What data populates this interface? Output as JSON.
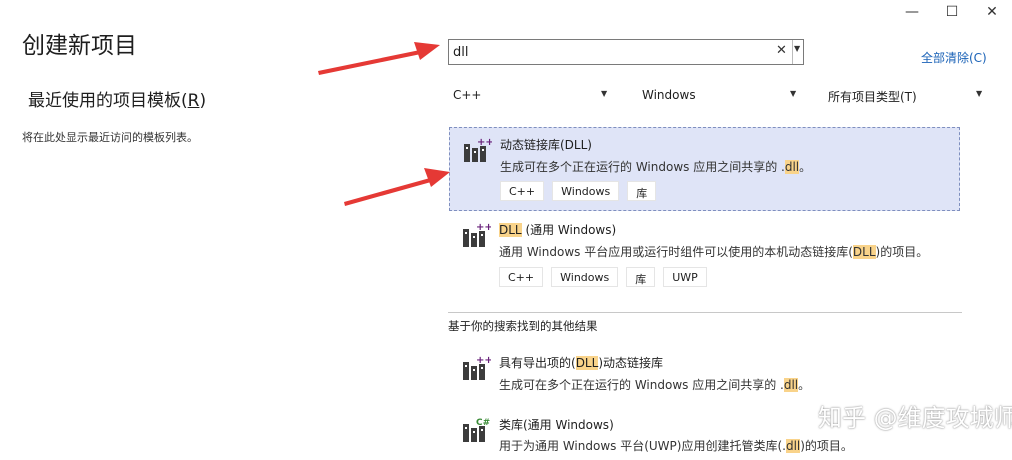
{
  "window": {
    "minimize_glyph": "—",
    "maximize_glyph": "☐",
    "close_glyph": "✕"
  },
  "page_title": "创建新项目",
  "recent": {
    "title_prefix": "最近使用的项目模板(",
    "title_hotkey": "R",
    "title_suffix": ")",
    "empty_text": "将在此处显示最近访问的模板列表。"
  },
  "search": {
    "value": "dll",
    "clear_glyph": "✕",
    "dropdown_glyph": "▼"
  },
  "clear_all": "全部清除(C)",
  "filters": {
    "language": "C++",
    "platform": "Windows",
    "project_type": "所有项目类型(T)",
    "caret": "▼"
  },
  "results": [
    {
      "title_hl": "动态链接库(DLL)",
      "title_rest": "",
      "desc_before": "生成可在多个正在运行的 Windows 应用之间共享的 .",
      "desc_hl": "dll",
      "desc_after": "。",
      "tags": [
        "C++",
        "Windows",
        "库"
      ],
      "icon_badge": "++"
    },
    {
      "title_hl": "DLL",
      "title_rest": " (通用 Windows)",
      "desc_before": "通用 Windows 平台应用或运行时组件可以使用的本机动态链接库(",
      "desc_hl": "DLL",
      "desc_after": ")的项目。",
      "tags": [
        "C++",
        "Windows",
        "库",
        "UWP"
      ],
      "icon_badge": "++"
    }
  ],
  "other_results_label": "基于你的搜索找到的其他结果",
  "other_results": [
    {
      "title_before": "具有导出项的(",
      "title_hl": "DLL",
      "title_after": ")动态链接库",
      "desc_before": "生成可在多个正在运行的 Windows 应用之间共享的 .",
      "desc_hl": "dll",
      "desc_after": "。",
      "icon_badge": "++"
    },
    {
      "title_before": "类库(通用 Windows)",
      "title_hl": "",
      "title_after": "",
      "desc_before": "用于为通用 Windows 平台(UWP)应用创建托管类库(.",
      "desc_hl": "dll",
      "desc_after": ")的项目。",
      "icon_badge": "C#"
    }
  ],
  "watermark": "知乎 @维度攻城师",
  "colors": {
    "accent_link": "#1a62b7",
    "selected_bg": "#dfe4f7",
    "highlight": "#f9d38a",
    "arrow": "#e53935"
  }
}
